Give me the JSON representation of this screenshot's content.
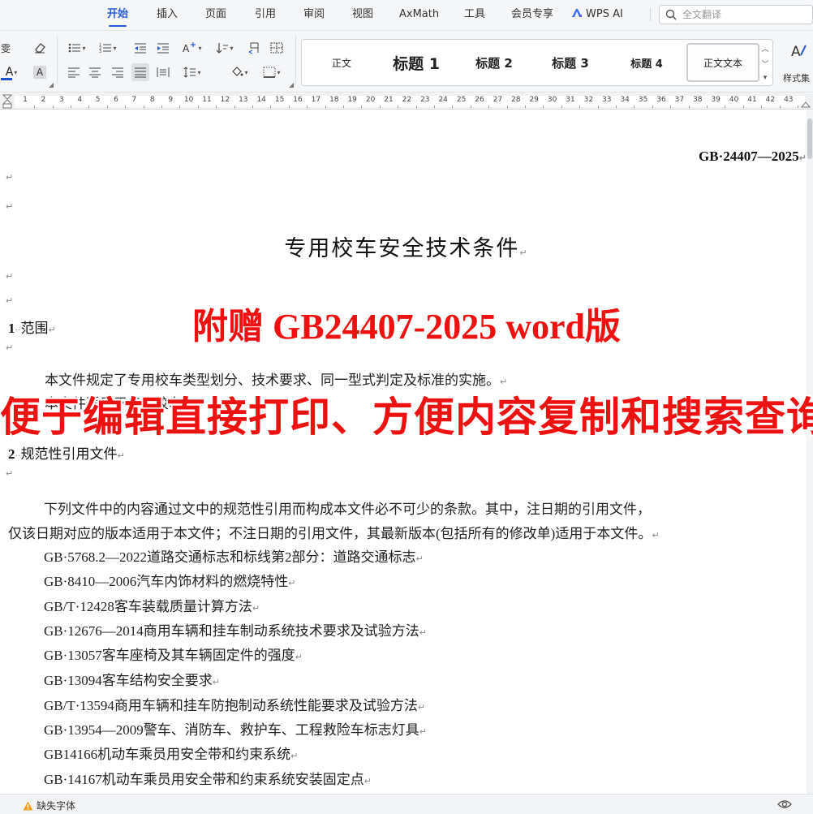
{
  "menubar": {
    "tabs": [
      {
        "id": "home",
        "label": "开始",
        "active": true
      },
      {
        "id": "insert",
        "label": "插入"
      },
      {
        "id": "page",
        "label": "页面"
      },
      {
        "id": "references",
        "label": "引用"
      },
      {
        "id": "review",
        "label": "审阅"
      },
      {
        "id": "view",
        "label": "视图"
      },
      {
        "id": "axmath",
        "label": "AxMath"
      },
      {
        "id": "tools",
        "label": "工具"
      },
      {
        "id": "member",
        "label": "会员专享"
      },
      {
        "id": "wps_ai",
        "label": "WPS AI"
      }
    ],
    "search_placeholder": "全文翻译",
    "accent_color": "#2b5bd7"
  },
  "ribbon": {
    "font_color_glyph": "A",
    "highlight_glyph": "A",
    "font_color": "#1f4fd1",
    "styles": [
      {
        "id": "normal",
        "label": "正文"
      },
      {
        "id": "h1",
        "label": "标题 1"
      },
      {
        "id": "h2",
        "label": "标题 2"
      },
      {
        "id": "h3",
        "label": "标题 3"
      },
      {
        "id": "h4",
        "label": "标题 4"
      },
      {
        "id": "body_text",
        "label": "正文文本",
        "selected": true
      }
    ],
    "style_set_label": "样式集"
  },
  "ruler": {
    "numbers": [
      "1",
      "2",
      "3",
      "4",
      "5",
      "6",
      "7",
      "8",
      "9",
      "10",
      "11",
      "12",
      "13",
      "14",
      "15",
      "16",
      "17",
      "18",
      "19",
      "20",
      "21",
      "22",
      "23",
      "24",
      "25",
      "26",
      "27",
      "28",
      "29",
      "30",
      "31",
      "32",
      "33",
      "34",
      "35",
      "36",
      "37",
      "38",
      "39",
      "40",
      "41",
      "42",
      "43"
    ]
  },
  "document": {
    "paragraph_mark": "↵",
    "standard_number": "GB·24407—2025",
    "title": "专用校车安全技术条件",
    "section1": {
      "number": "1",
      "title": "范围"
    },
    "section1_body": "本文件规定了专用校车类型划分、技术要求、同一型式判定及标准的实施。",
    "section1_body_line2": "本文件适用于专用校车。",
    "section2": {
      "number": "2",
      "title": "规范性引用文件"
    },
    "section2_body_line1": "下列文件中的内容通过文中的规范性引用而构成本文件必不可少的条款。其中，注日期的引用文件，",
    "section2_body_line2": "仅该日期对应的版本适用于本文件；不注日期的引用文件，其最新版本(包括所有的修改单)适用于本文件。",
    "references": [
      "GB·5768.2—2022道路交通标志和标线第2部分：道路交通标志",
      "GB·8410—2006汽车内饰材料的燃烧特性",
      "GB/T·12428客车装载质量计算方法",
      "GB·12676—2014商用车辆和挂车制动系统技术要求及试验方法",
      "GB·13057客车座椅及其车辆固定件的强度",
      "GB·13094客车结构安全要求",
      "GB/T·13594商用车辆和挂车防抱制动系统性能要求及试验方法",
      "GB·13954—2009警车、消防车、救护车、工程救险车标志灯具",
      "GB14166机动车乘员用安全带和约束系统",
      "GB·14167机动车乘员用安全带和约束系统安装固定点"
    ]
  },
  "promo": {
    "line1": "附赠 GB24407-2025 word版",
    "line2": "便于编辑直接打印、方便内容复制和搜索查询",
    "color": "#ee1111"
  },
  "statusbar": {
    "missing_fonts": "缺失字体"
  }
}
